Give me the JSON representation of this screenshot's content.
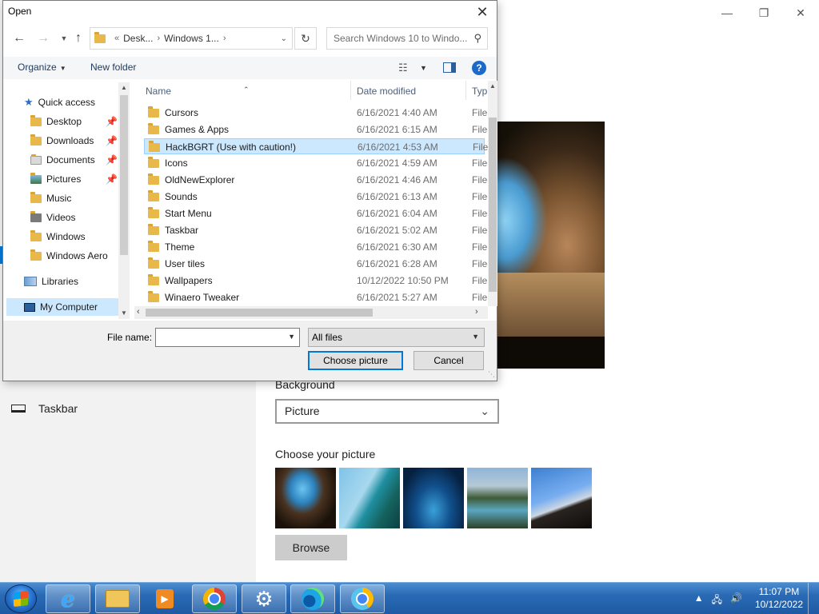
{
  "dialog": {
    "title": "Open",
    "address": {
      "seg1": "Desk...",
      "seg2": "Windows 1..."
    },
    "search_placeholder": "Search Windows 10 to Windo...",
    "toolbar": {
      "organize": "Organize",
      "new_folder": "New folder"
    },
    "nav": [
      {
        "label": "Quick access"
      },
      {
        "label": "Desktop"
      },
      {
        "label": "Downloads"
      },
      {
        "label": "Documents"
      },
      {
        "label": "Pictures"
      },
      {
        "label": "Music"
      },
      {
        "label": "Videos"
      },
      {
        "label": "Windows"
      },
      {
        "label": "Windows Aero"
      },
      {
        "label": "Libraries"
      },
      {
        "label": "My Computer"
      }
    ],
    "columns": {
      "name": "Name",
      "date": "Date modified",
      "type": "Typ"
    },
    "files": [
      {
        "name": "Cursors",
        "date": "6/16/2021 4:40 AM",
        "type": "File"
      },
      {
        "name": "Games & Apps",
        "date": "6/16/2021 6:15 AM",
        "type": "File"
      },
      {
        "name": "HackBGRT (Use with caution!)",
        "date": "6/16/2021 4:53 AM",
        "type": "File"
      },
      {
        "name": "Icons",
        "date": "6/16/2021 4:59 AM",
        "type": "File"
      },
      {
        "name": "OldNewExplorer",
        "date": "6/16/2021 4:46 AM",
        "type": "File"
      },
      {
        "name": "Sounds",
        "date": "6/16/2021 6:13 AM",
        "type": "File"
      },
      {
        "name": "Start Menu",
        "date": "6/16/2021 6:04 AM",
        "type": "File"
      },
      {
        "name": "Taskbar",
        "date": "6/16/2021 5:02 AM",
        "type": "File"
      },
      {
        "name": "Theme",
        "date": "6/16/2021 6:30 AM",
        "type": "File"
      },
      {
        "name": "User tiles",
        "date": "6/16/2021 6:28 AM",
        "type": "File"
      },
      {
        "name": "Wallpapers",
        "date": "10/12/2022 10:50 PM",
        "type": "File"
      },
      {
        "name": "Winaero Tweaker",
        "date": "6/16/2021 5:27 AM",
        "type": "File"
      }
    ],
    "selected_file": "HackBGRT (Use with caution!)",
    "file_name_label": "File name:",
    "file_name_value": "",
    "file_type": "All files",
    "choose_button": "Choose picture",
    "cancel_button": "Cancel"
  },
  "settings": {
    "nav_taskbar": "Taskbar",
    "background_label": "Background",
    "background_value": "Picture",
    "choose_picture_label": "Choose your picture",
    "browse_button": "Browse"
  },
  "taskbar": {
    "time": "11:07 PM",
    "date": "10/12/2022"
  },
  "colors": {
    "selection": "#cce8ff",
    "accent": "#0078d7",
    "taskbar": "#2a6ab5"
  }
}
